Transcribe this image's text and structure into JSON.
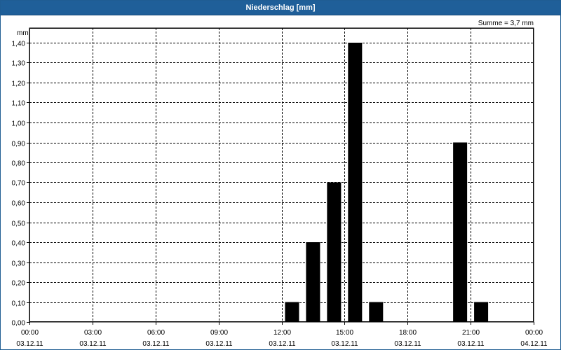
{
  "window": {
    "title": "Niederschlag [mm]"
  },
  "summary": "Summe = 3,7 mm",
  "chart_data": {
    "type": "bar",
    "title": "Niederschlag [mm]",
    "ylabel": "mm",
    "xlabel": "",
    "ylim": [
      0,
      1.4
    ],
    "yticks": [
      "0,00",
      "0,10",
      "0,20",
      "0,30",
      "0,40",
      "0,50",
      "0,60",
      "0,70",
      "0,80",
      "0,90",
      "1,00",
      "1,10",
      "1,20",
      "1,30",
      "1,40"
    ],
    "xticks": [
      {
        "time": "00:00",
        "date": "03.12.11"
      },
      {
        "time": "03:00",
        "date": "03.12.11"
      },
      {
        "time": "06:00",
        "date": "03.12.11"
      },
      {
        "time": "09:00",
        "date": "03.12.11"
      },
      {
        "time": "12:00",
        "date": "03.12.11"
      },
      {
        "time": "15:00",
        "date": "03.12.11"
      },
      {
        "time": "18:00",
        "date": "03.12.11"
      },
      {
        "time": "21:00",
        "date": "03.12.11"
      },
      {
        "time": "00:00",
        "date": "04.12.11"
      }
    ],
    "x_range_hours": [
      0,
      24
    ],
    "bars": [
      {
        "hour": 13,
        "value": 0.1
      },
      {
        "hour": 14,
        "value": 0.4
      },
      {
        "hour": 15,
        "value": 0.7
      },
      {
        "hour": 16,
        "value": 1.4
      },
      {
        "hour": 17,
        "value": 0.1
      },
      {
        "hour": 21,
        "value": 0.9
      },
      {
        "hour": 22,
        "value": 0.1
      }
    ],
    "bar_color": "#000000",
    "grid": true
  }
}
